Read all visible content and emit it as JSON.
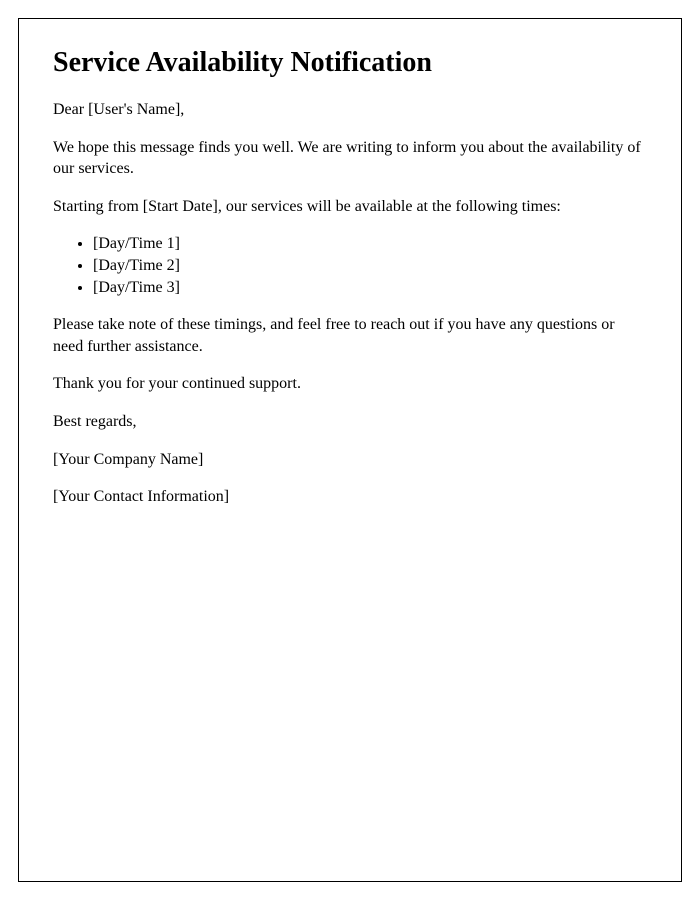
{
  "title": "Service Availability Notification",
  "greeting": "Dear [User's Name],",
  "intro": "We hope this message finds you well. We are writing to inform you about the availability of our services.",
  "schedule_lead": "Starting from [Start Date], our services will be available at the following times:",
  "schedule_items": {
    "item1": "[Day/Time 1]",
    "item2": "[Day/Time 2]",
    "item3": "[Day/Time 3]"
  },
  "note": "Please take note of these timings, and feel free to reach out if you have any questions or need further assistance.",
  "thanks": "Thank you for your continued support.",
  "signoff": "Best regards,",
  "company": "[Your Company Name]",
  "contact": "[Your Contact Information]"
}
